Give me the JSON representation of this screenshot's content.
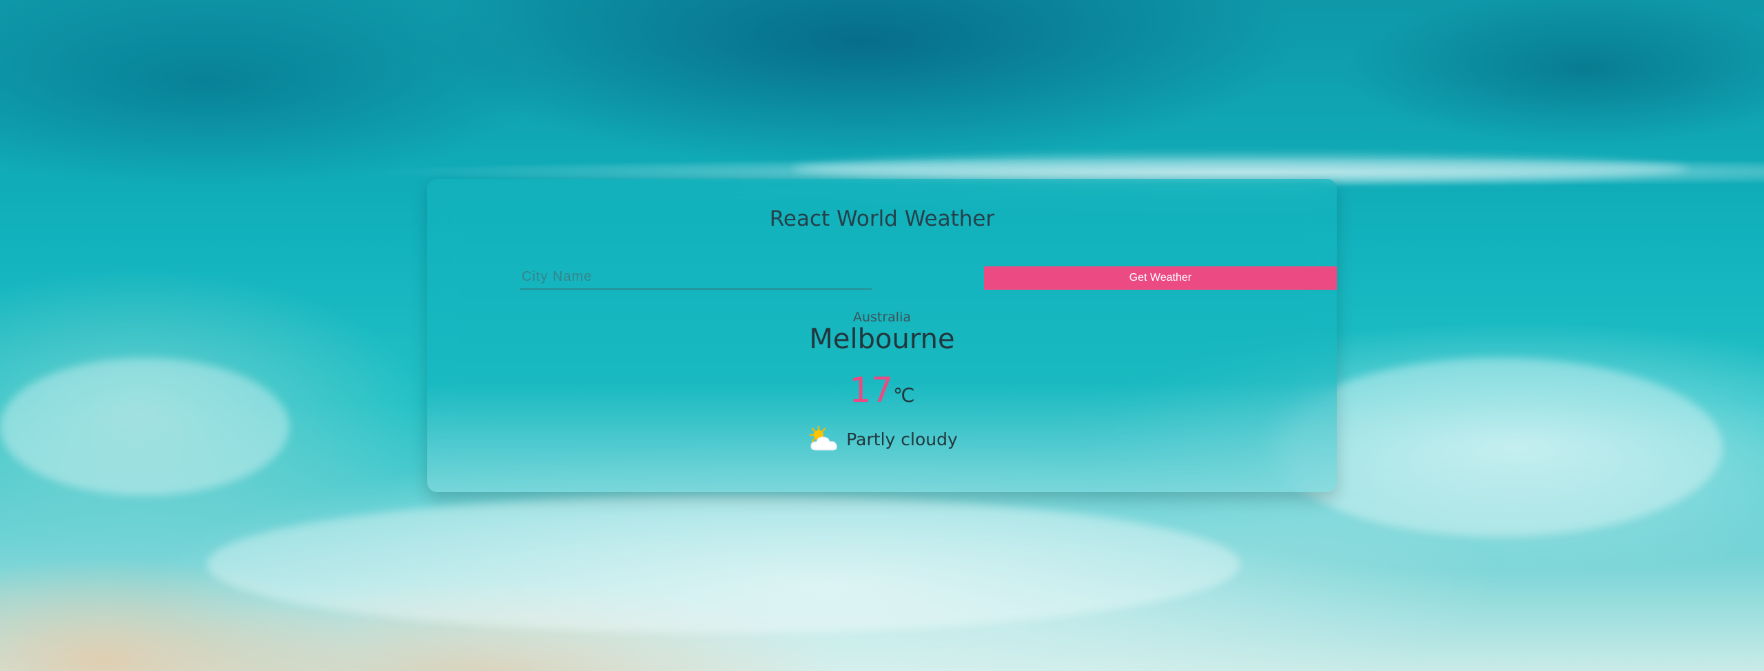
{
  "app": {
    "title": "React World Weather"
  },
  "search": {
    "placeholder": "City Name",
    "value": "",
    "button_label": "Get Weather"
  },
  "weather": {
    "country": "Australia",
    "city": "Melbourne",
    "temperature": "17",
    "unit": "℃",
    "condition": "Partly cloudy",
    "condition_icon": "partly-cloudy-icon"
  },
  "colors": {
    "accent": "#ec4a82",
    "card": "#14b4be",
    "text": "#22373d"
  }
}
